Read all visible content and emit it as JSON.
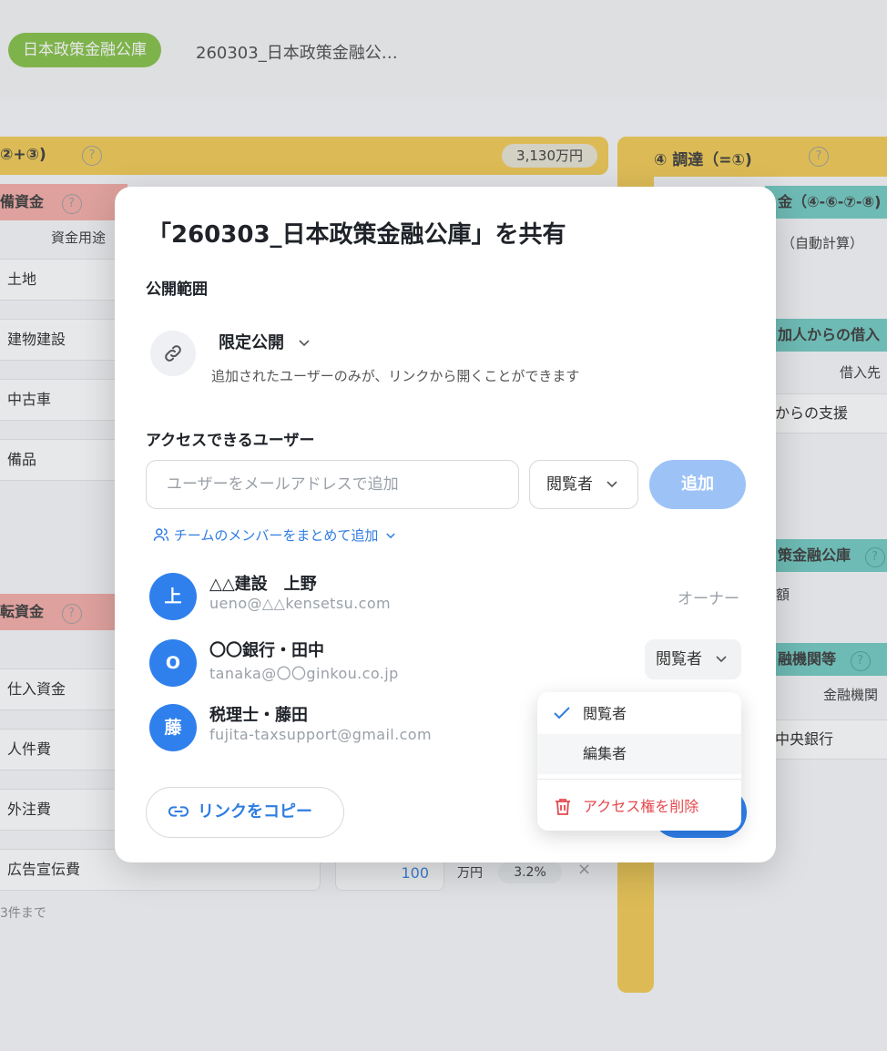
{
  "header": {
    "brand": "日本政策金融公庫",
    "doc_title": "260303_日本政策金融公…"
  },
  "background": {
    "left_bar_label": "②+③)",
    "left_bar_amount": "3,130万円",
    "right_bar_label": "④ 調達（=①)",
    "left_head_1": "備資金",
    "fund_use_label": "資金用途",
    "left_rows_1": [
      "土地",
      "建物建設",
      "中古車",
      "備品"
    ],
    "left_head_2": "転資金",
    "left_rows_2": [
      "仕入資金",
      "人件費",
      "外注費",
      "広告宣伝費"
    ],
    "ad_amount": "100",
    "ad_unit": "万円",
    "ad_percent": "3.2%",
    "limit_note": "3件まで",
    "right_green_1": "金（④-⑥-⑦-⑧)",
    "right_auto": "（自動計算）",
    "right_green_2": "加人からの借入",
    "right_borrow_from": "借入先",
    "right_support": "からの支援",
    "right_green_3": "策金融公庫",
    "right_amount": "額",
    "right_green_4": "融機関等",
    "right_institution": "金融機関",
    "right_bank": "中央銀行"
  },
  "modal": {
    "title": "「260303_日本政策金融公庫」を共有",
    "scope_label": "公開範囲",
    "scope_value": "限定公開",
    "scope_desc": "追加されたユーザーのみが、リンクから開くことができます",
    "access_label": "アクセスできるユーザー",
    "email_placeholder": "ユーザーをメールアドレスで追加",
    "role_value": "閲覧者",
    "add_label": "追加",
    "team_add_label": "チームのメンバーをまとめて追加",
    "users": [
      {
        "initial": "上",
        "name": "△△建設　上野",
        "email": "ueno@△△kensetsu.com",
        "role": "オーナー"
      },
      {
        "initial": "O",
        "name": "〇〇銀行・田中",
        "email": "tanaka@〇〇ginkou.co.jp",
        "role": "閲覧者"
      },
      {
        "initial": "藤",
        "name": "税理士・藤田",
        "email": "fujita-taxsupport@gmail.com",
        "role": ""
      }
    ],
    "copy_link_label": "リンクをコピー"
  },
  "dropdown": {
    "options": [
      "閲覧者",
      "編集者"
    ],
    "selected": "閲覧者",
    "delete_label": "アクセス権を削除"
  },
  "colors": {
    "accent": "#2f80ed",
    "brand": "#7fbf3f",
    "danger": "#e5484d"
  }
}
